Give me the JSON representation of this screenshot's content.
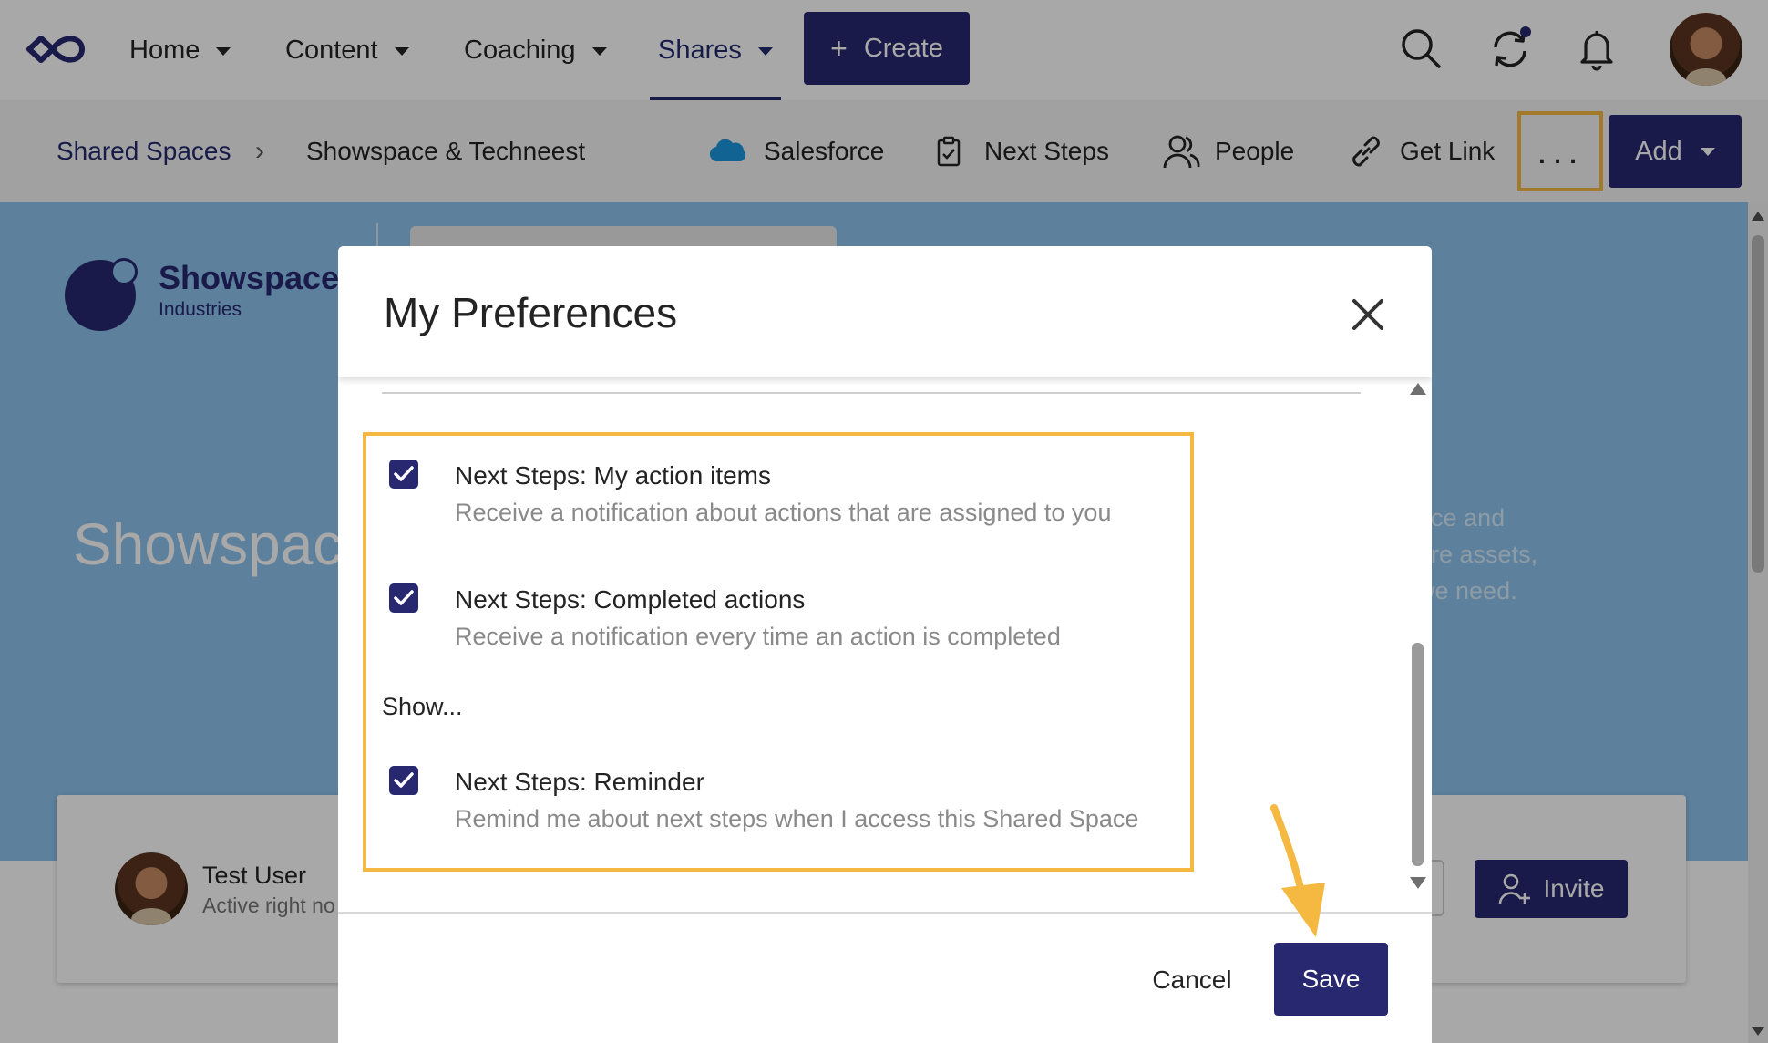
{
  "nav": {
    "items": [
      {
        "label": "Home",
        "active": false
      },
      {
        "label": "Content",
        "active": false
      },
      {
        "label": "Coaching",
        "active": false
      },
      {
        "label": "Shares",
        "active": true
      }
    ],
    "create_label": "Create",
    "sync_badge_color": "#27286f"
  },
  "subbar": {
    "breadcrumb": [
      "Shared Spaces",
      "Showspace & Techneest"
    ],
    "actions": {
      "salesforce": "Salesforce",
      "next_steps": "Next Steps",
      "people": "People",
      "get_link": "Get Link"
    },
    "more_label": "...",
    "add_label": "Add"
  },
  "page": {
    "logo_name": "Showspace",
    "logo_sub": "Industries",
    "title": "Showspace",
    "description_lines": [
      "pace and",
      "hare assets,",
      "t we need."
    ],
    "team_member": {
      "name": "Test User",
      "status": "Active right no"
    },
    "invite_label": "Invite"
  },
  "modal": {
    "title": "My Preferences",
    "preferences": [
      {
        "title": "Next Steps: My action items",
        "description": "Receive a notification about actions that are assigned to you",
        "checked": true
      },
      {
        "title": "Next Steps: Completed actions",
        "description": "Receive a notification every time an action is completed",
        "checked": true
      },
      {
        "title": "Next Steps: Reminder",
        "description": "Remind me about next steps when I access this Shared Space",
        "checked": true
      }
    ],
    "show_label": "Show...",
    "cancel_label": "Cancel",
    "save_label": "Save"
  },
  "colors": {
    "brand": "#27286f",
    "highlight": "#f5b840",
    "hero_bg": "#8dc2ee"
  }
}
